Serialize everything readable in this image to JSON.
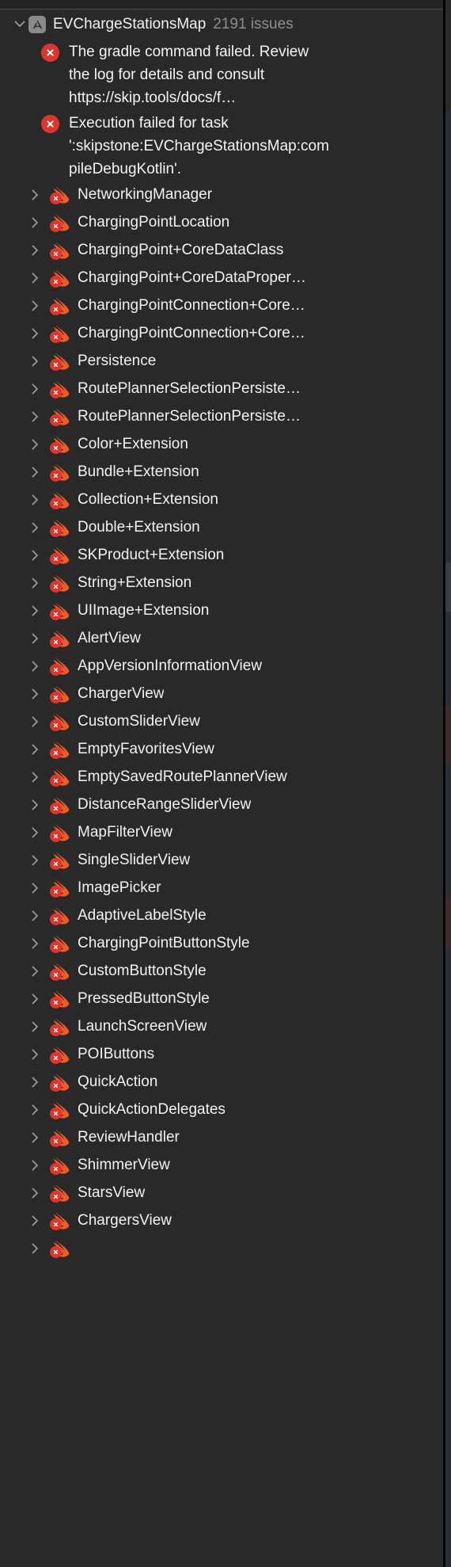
{
  "panel": {
    "name": "issue-navigator",
    "background_color": "#292929",
    "divider_color": "#4a4a48"
  },
  "project": {
    "disclosure_state": "expanded",
    "disclosure_icon": "chevron-down-icon",
    "app_icon": "app-store-icon",
    "name": "EVChargeStationsMap",
    "issue_count_label": "2191 issues"
  },
  "issues": [
    {
      "icon": "error-circle-icon",
      "severity": "error",
      "color": "#e0352b",
      "message": "The gradle command failed. Review the log for details and consult https://skip.tools/docs/f…"
    },
    {
      "icon": "error-circle-icon",
      "severity": "error",
      "color": "#e0352b",
      "message": "Execution failed for task ':skipstone:EVChargeStationsMap:compileDebugKotlin'."
    }
  ],
  "file_row_icons": {
    "disclosure": "chevron-right-icon",
    "file": "swift-file-icon",
    "badge": "error-badge-icon",
    "swift_color": "#f05a28",
    "badge_color": "#e0352b"
  },
  "files": [
    {
      "name": "NetworkingManager"
    },
    {
      "name": "ChargingPointLocation"
    },
    {
      "name": "ChargingPoint+CoreDataClass"
    },
    {
      "name": "ChargingPoint+CoreDataProper…"
    },
    {
      "name": "ChargingPointConnection+Core…"
    },
    {
      "name": "ChargingPointConnection+Core…"
    },
    {
      "name": "Persistence"
    },
    {
      "name": "RoutePlannerSelectionPersiste…"
    },
    {
      "name": "RoutePlannerSelectionPersiste…"
    },
    {
      "name": "Color+Extension"
    },
    {
      "name": "Bundle+Extension"
    },
    {
      "name": "Collection+Extension"
    },
    {
      "name": "Double+Extension"
    },
    {
      "name": "SKProduct+Extension"
    },
    {
      "name": "String+Extension"
    },
    {
      "name": "UIImage+Extension"
    },
    {
      "name": "AlertView"
    },
    {
      "name": "AppVersionInformationView"
    },
    {
      "name": "ChargerView"
    },
    {
      "name": "CustomSliderView"
    },
    {
      "name": "EmptyFavoritesView"
    },
    {
      "name": "EmptySavedRoutePlannerView"
    },
    {
      "name": "DistanceRangeSliderView"
    },
    {
      "name": "MapFilterView"
    },
    {
      "name": "SingleSliderView"
    },
    {
      "name": "ImagePicker"
    },
    {
      "name": "AdaptiveLabelStyle"
    },
    {
      "name": "ChargingPointButtonStyle"
    },
    {
      "name": "CustomButtonStyle"
    },
    {
      "name": "PressedButtonStyle"
    },
    {
      "name": "LaunchScreenView"
    },
    {
      "name": "POIButtons"
    },
    {
      "name": "QuickAction"
    },
    {
      "name": "QuickActionDelegates"
    },
    {
      "name": "ReviewHandler"
    },
    {
      "name": "ShimmerView"
    },
    {
      "name": "StarsView"
    },
    {
      "name": "ChargersView"
    },
    {
      "name": ""
    }
  ]
}
